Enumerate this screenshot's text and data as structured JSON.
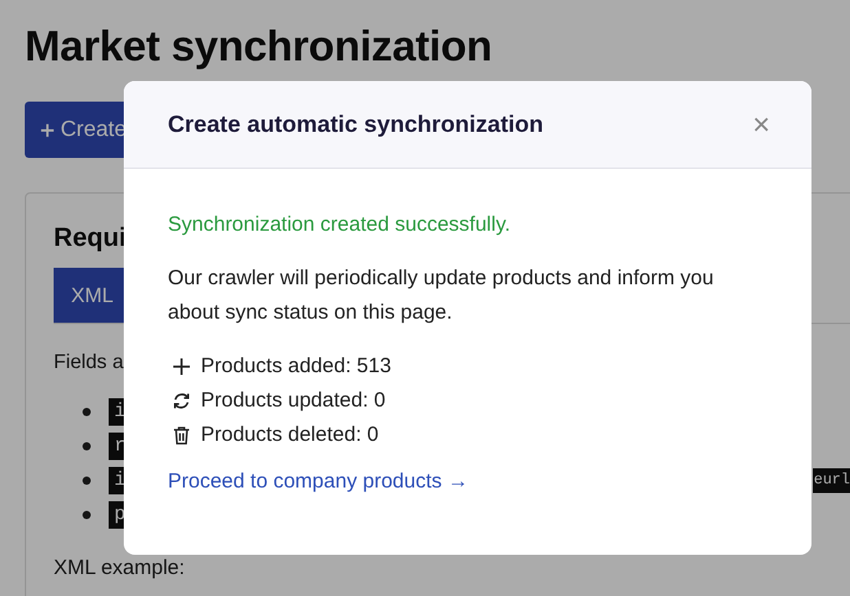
{
  "page": {
    "title": "Market synchronization",
    "create_button": {
      "label": "Create"
    },
    "card": {
      "heading": "Requi",
      "tabs": [
        {
          "label": "XML",
          "selected": true
        }
      ],
      "fields_text": "Fields a",
      "fields": [
        {
          "code": "i"
        },
        {
          "code": "r"
        },
        {
          "code": "i",
          "tail": "eurl"
        },
        {
          "code": "p"
        }
      ],
      "example_label": "XML example:"
    }
  },
  "dialog": {
    "title": "Create automatic synchronization",
    "close": "×",
    "success": "Synchronization created successfully.",
    "message": "Our crawler will periodically update products and inform you about sync status on this page.",
    "stats": [
      {
        "kind": "added",
        "text": "Products added: 513"
      },
      {
        "kind": "updated",
        "text": "Products updated: 0"
      },
      {
        "kind": "deleted",
        "text": "Products deleted: 0"
      }
    ],
    "link": "Proceed to company products →"
  }
}
